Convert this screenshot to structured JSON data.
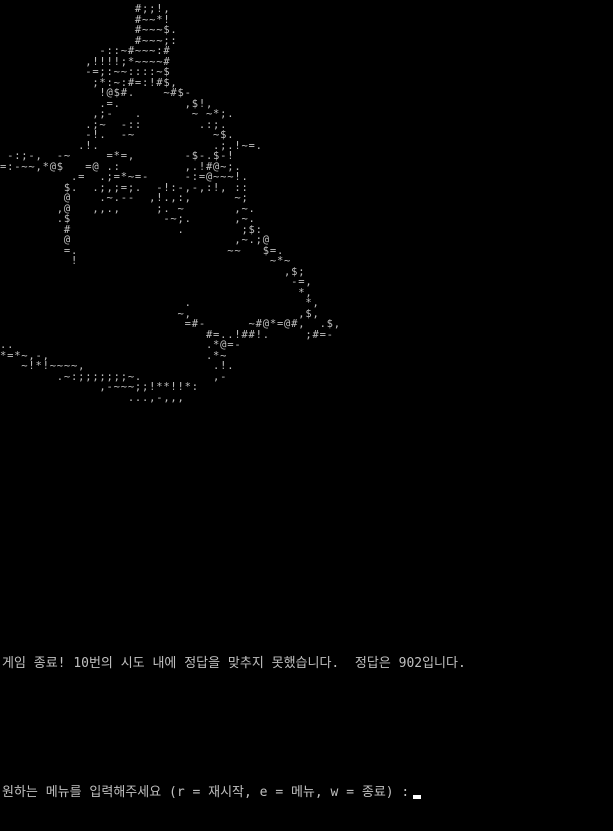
{
  "console": {
    "ascii_art": [
      "                   #;;!,",
      "                   #~~*!",
      "                   #~~~$.",
      "                   #~~~;:",
      "              -::~#~~~:#",
      "            ,!!!!;*~~~~#",
      "            -=;:~~::::~$",
      "             ;*:~:#=:!#$,",
      "              !@$#.    ~#$-",
      "              .=.         ,$!,",
      "             ,;-   .       ~ ~*;.",
      "            .;~  -::        .:;.",
      "            -!.  -~           ~$.",
      "           .!.                .;.!~=.",
      " -:;-,  -~     =*=,       -$-.$-!",
      "=:-~~,*@$   =@ .:         ,.!#@~;.",
      "          .=  .;=*~=-     -:=@~~~!.",
      "         $.  .;,;=;.  -!:-,-,:!, ::",
      "         @    .~.--  ,!.,:,      ~;",
      "        ,@   ,,.,     ;. ~       ,~.",
      "        .$             -~;.      ,~.",
      "         #               .        ;$:",
      "         @                       ,~.;@",
      "         =.                     ~~   $=.",
      "          !                           ~*~",
      "                                        ,$;",
      "                                         -=,",
      "                                          *,",
      "                          .                *,",
      "                         ~,               ,$,",
      "                          =#-      ~#@*=@#,  .$,",
      "                             #=..!##!.     ;#=-",
      "..                           .*@=-",
      "*=*~,-,                      .*~",
      "   ~!*!~~~~,                  .!.",
      "        .~:;;;;;;;~.          ,-",
      "              ,-~~~;;!**!!*:",
      "                  ...,-,,,"
    ],
    "result_message": "게임 종료! 10번의 시도 내에 정답을 맞추지 못했습니다.  정답은 902입니다.",
    "menu_prompt": "원하는 메뉴를 입력해주세요 (r = 재시작, e = 메뉴, w = 종료) :"
  }
}
